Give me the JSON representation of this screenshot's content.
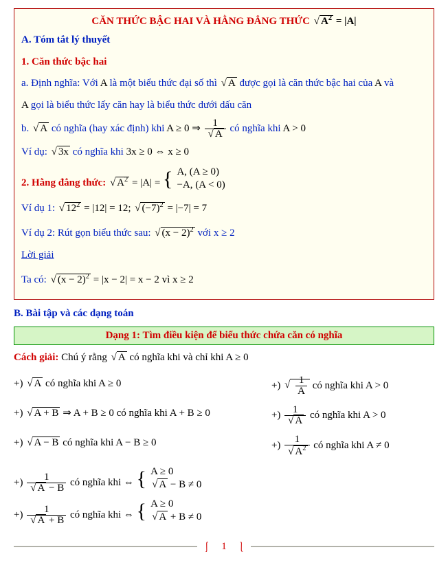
{
  "title_prefix": "CĂN THỨC BẬC HAI VÀ HẰNG ĐẲNG THỨC ",
  "sectionA": "A. Tóm tắt lý thuyết",
  "h1": "1. Căn thức bậc hai",
  "def_a_label": "a. Định nghĩa:",
  "def_a_body1": " Với ",
  "A": "A",
  "def_a_body2": " là một biểu thức đại số thì ",
  "def_a_body3": " được gọi là căn thức bậc hai của ",
  "def_a_body4": " và ",
  "def_a_line2": " gọi là biểu thức lấy căn hay là biểu thức dưới dấu căn",
  "b_label": "b. ",
  "b_text1": " có nghĩa (hay xác định) khi ",
  "b_cond1": "A ≥ 0",
  "b_arrow": " ⇒ ",
  "b_text2": " có nghĩa khi ",
  "b_cond2": "A > 0",
  "ex1_pre": "Ví dụ: ",
  "ex1_mid": " có nghĩa khi ",
  "ex1_cond": "3x ≥ 0 ⇔ x ≥ 0",
  "h2": "2. Hằng đẳng thức: ",
  "id_eq": " = |A| = ",
  "id_case1": "A, (A ≥ 0)",
  "id_case2": "−A, (A < 0)",
  "vd1_label": "Ví dụ 1: ",
  "vd1_a": " = |12| = 12; ",
  "vd1_b": " = |−7| = 7",
  "vd2_label": "Ví dụ 2: Rút gọn biểu thức sau: ",
  "vd2_cond": "  với  x ≥ 2",
  "loigiai": "Lời giải",
  "taco": "Ta có: ",
  "taco_eq": " = |x − 2| = x − 2  vì  x ≥ 2",
  "sectionB": "B. Bài tập và các dạng toán",
  "dang1": "Dạng 1: Tìm điều kiện để biểu thức chứa căn có nghĩa",
  "cachgiai_label": "Cách giải: ",
  "cachgiai_body": "Chú ý rằng ",
  "cachgiai_mid": " có nghĩa khi và chỉ khi ",
  "cachgiai_cond": "A ≥ 0",
  "plus": "+) ",
  "co_nghia_khi": " có nghĩa khi ",
  "co_nghia_khi_iff": " có nghĩa khi ⇔ ",
  "cond_Age0": "A ≥ 0",
  "cond_Agt0": "A > 0",
  "cond_ABge0": "A + B ≥ 0",
  "cond_AmBge0": "A − B ≥ 0",
  "cond_Ane0": "A ≠ 0",
  "impl": " ⇒ ",
  "case_row1": "A ≥ 0",
  "case_row2a": " − B ≠ 0",
  "case_row2b": " + B ≠ 0",
  "rad_A": "A",
  "rad_3x": "3x",
  "rad_A2": "A",
  "rad_12_2": "12",
  "rad_m7_2": "(−7)",
  "rad_xm2_2": "(x − 2)",
  "rad_ApB": "A + B",
  "rad_AmB": "A − B",
  "num1": "1",
  "pageNum": "1",
  "lbrace": "⎰",
  "rbrace": "⎱"
}
